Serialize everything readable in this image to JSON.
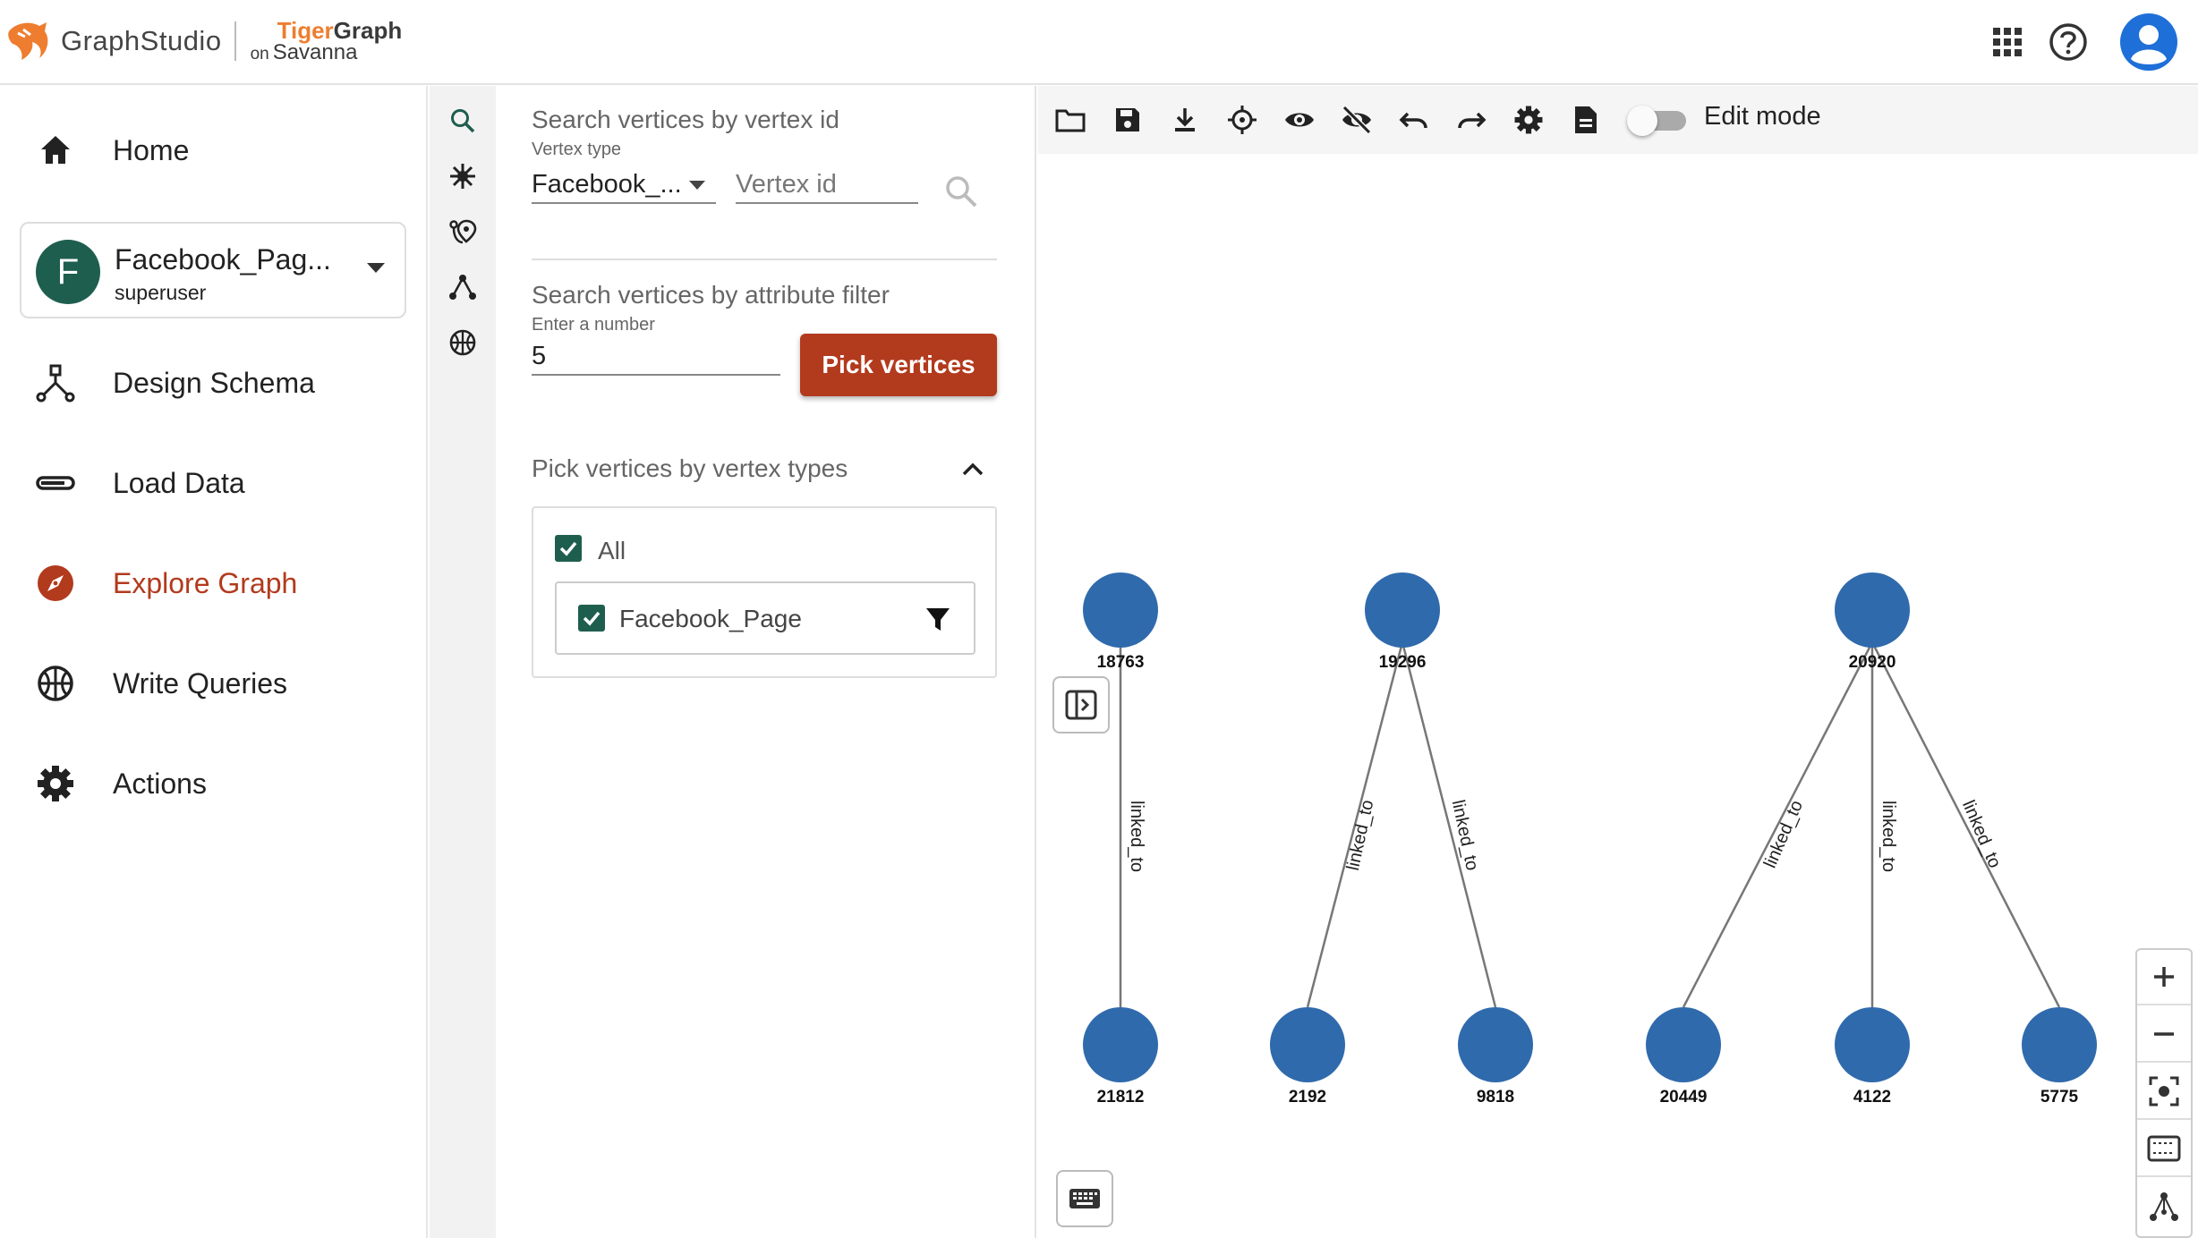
{
  "header": {
    "app_name": "GraphStudio",
    "brand_tiger": "Tiger",
    "brand_graph": "Graph",
    "brand_on": "on",
    "brand_savanna": "Savanna",
    "icons": [
      "apps-grid-icon",
      "help-icon",
      "account-icon"
    ]
  },
  "nav": {
    "home": "Home",
    "graph_name": "Facebook_Pag...",
    "graph_user": "superuser",
    "graph_initial": "F",
    "design_schema": "Design Schema",
    "load_data": "Load Data",
    "explore_graph": "Explore Graph",
    "write_queries": "Write Queries",
    "actions": "Actions"
  },
  "search": {
    "by_id_title": "Search vertices by vertex id",
    "vertex_type_label": "Vertex type",
    "vertex_type_value": "Facebook_...",
    "vertex_id_placeholder": "Vertex id",
    "by_attr_title": "Search vertices by attribute filter",
    "number_label": "Enter a number",
    "number_value": "5",
    "pick_button": "Pick vertices",
    "by_types_title": "Pick vertices by vertex types",
    "all_label": "All",
    "type_item": "Facebook_Page"
  },
  "toolbar": {
    "edit_mode_label": "Edit mode",
    "edit_mode_on": false
  },
  "graph": {
    "edge_label": "linked_to",
    "node_color": "#2f6aac",
    "vertices": [
      "18763",
      "19296",
      "20920",
      "21812",
      "2192",
      "9818",
      "20449",
      "4122",
      "5775"
    ],
    "edges": [
      [
        "18763",
        "21812"
      ],
      [
        "19296",
        "2192"
      ],
      [
        "19296",
        "9818"
      ],
      [
        "20920",
        "20449"
      ],
      [
        "20920",
        "4122"
      ],
      [
        "20920",
        "5775"
      ]
    ]
  },
  "colors": {
    "accent": "#b23a1d",
    "check": "#1e5e4f"
  }
}
